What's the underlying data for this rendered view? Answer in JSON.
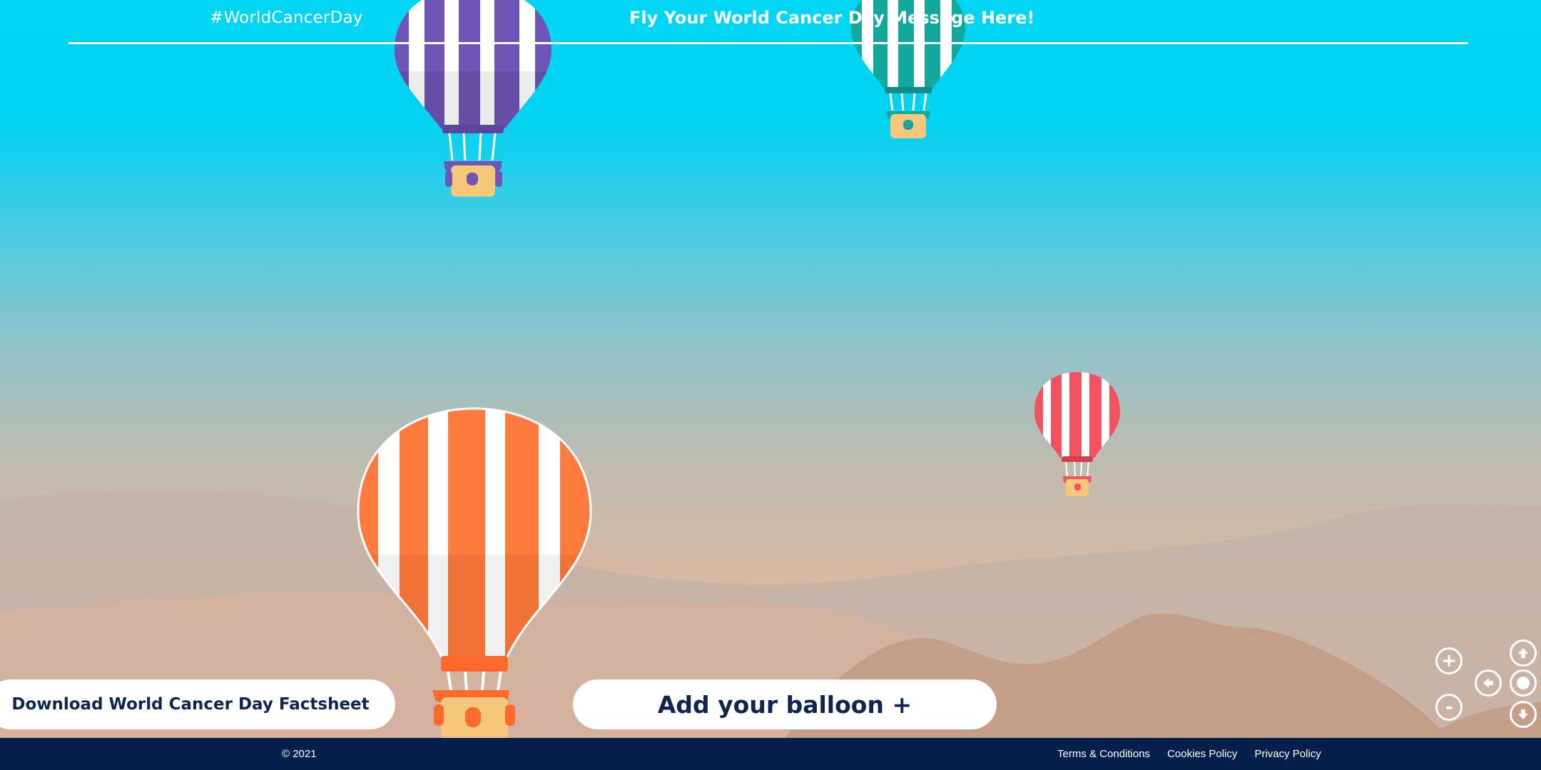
{
  "header": {
    "hashtag": "#WorldCancerDay",
    "title": "Fly Your World Cancer Day Message Here!"
  },
  "actions": {
    "factsheet_label": "Download World Cancer Day Factsheet",
    "add_balloon_label": "Add your balloon +"
  },
  "controls": {
    "zoom_in": "+",
    "zoom_out": "-"
  },
  "footer": {
    "copyright": "© 2021",
    "links": [
      "Terms & Conditions",
      "Cookies Policy",
      "Privacy Policy"
    ]
  },
  "colors": {
    "sky_top": "#00d6f4",
    "button_text": "#0d2650",
    "footer_bg": "#05204a",
    "balloon_orange": "#ff7a3d",
    "balloon_purple": "#6f55b5",
    "balloon_teal": "#12a89c",
    "balloon_red": "#f2515f"
  },
  "icons": {
    "zoom_in": "plus-icon",
    "zoom_out": "minus-icon",
    "pan_up": "arrow-up-icon",
    "pan_left": "arrow-left-icon",
    "pan_down": "arrow-down-icon",
    "center": "center-dot-icon"
  }
}
